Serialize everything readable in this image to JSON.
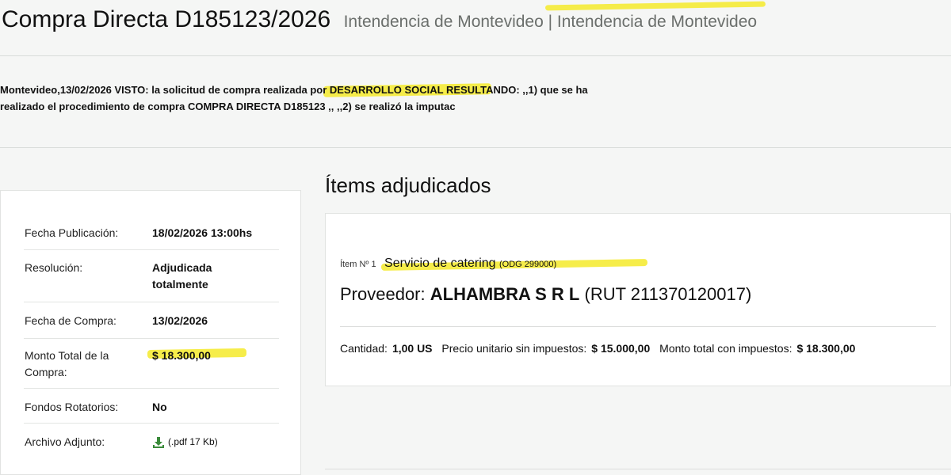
{
  "header": {
    "title": "Compra Directa D185123/2026",
    "subtitle": "Intendencia de Montevideo | Intendencia de Montevideo"
  },
  "description": {
    "line1": "Montevideo,13/02/2026 VISTO: la solicitud de compra realizada por DESARROLLO SOCIAL RESULTANDO: ,,1) que se ha",
    "line2": "realizado el procedimiento de compra COMPRA DIRECTA D185123 ,, ,,2) se realizó la imputac"
  },
  "details": {
    "rows": [
      {
        "label": "Fecha Publicación:",
        "value": "18/02/2026 13:00hs"
      },
      {
        "label": "Resolución:",
        "value": "Adjudicada totalmente"
      },
      {
        "label": "Fecha de Compra:",
        "value": "13/02/2026"
      },
      {
        "label": "Monto Total de la Compra:",
        "value": "$ 18.300,00"
      },
      {
        "label": "Fondos Rotatorios:",
        "value": "No"
      },
      {
        "label": "Archivo Adjunto:",
        "value": "(.pdf 17 Kb)"
      }
    ]
  },
  "items": {
    "title": "Ítems adjudicados",
    "list": [
      {
        "item_label": "Ítem Nº 1",
        "service": "Servicio de catering",
        "odg": "(ODG 299000)",
        "provider_prefix": "Proveedor:",
        "provider_name": "ALHAMBRA S R L",
        "provider_rut": "(RUT 211370120017)",
        "qty_label": "Cantidad:",
        "qty_value": "1,00 US",
        "unit_label": "Precio unitario sin impuestos:",
        "unit_value": "$ 15.000,00",
        "total_label": "Monto total con impuestos:",
        "total_value": "$ 18.300,00"
      }
    ]
  },
  "colors": {
    "highlight": "#f4ea2a",
    "download_icon": "#3a8a3a"
  },
  "icons": {
    "attachment": "download-icon"
  }
}
